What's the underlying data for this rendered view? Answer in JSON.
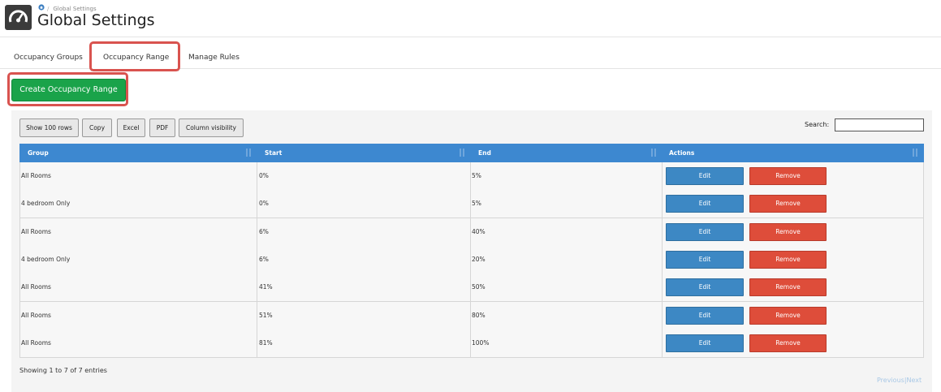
{
  "header": {
    "breadcrumb": "Global Settings",
    "title": "Global Settings"
  },
  "tabs": [
    {
      "label": "Occupancy Groups"
    },
    {
      "label": "Occupancy Range"
    },
    {
      "label": "Manage Rules"
    }
  ],
  "create_button": "Create Occupancy Range",
  "toolbar": {
    "show_rows": "Show 100 rows",
    "copy": "Copy",
    "excel": "Excel",
    "pdf": "PDF",
    "column_visibility": "Column visibility",
    "search_label": "Search:",
    "search_value": ""
  },
  "table": {
    "columns": [
      "Group",
      "Start",
      "End",
      "Actions"
    ],
    "edit_label": "Edit",
    "remove_label": "Remove",
    "rows": [
      {
        "group": "All Rooms",
        "start": "0%",
        "end": "5%"
      },
      {
        "group": "4 bedroom Only",
        "start": "0%",
        "end": "5%"
      },
      {
        "group": "All Rooms",
        "start": "6%",
        "end": "40%"
      },
      {
        "group": "4 bedroom Only",
        "start": "6%",
        "end": "20%"
      },
      {
        "group": "All Rooms",
        "start": "41%",
        "end": "50%"
      },
      {
        "group": "All Rooms",
        "start": "51%",
        "end": "80%"
      },
      {
        "group": "All Rooms",
        "start": "81%",
        "end": "100%"
      }
    ]
  },
  "footer": {
    "info": "Showing 1 to 7 of 7 entries",
    "previous": "Previous",
    "next": "Next"
  },
  "colors": {
    "header_blue": "#3d88d0",
    "create_green": "#1aa34a",
    "edit_blue": "#3d88c4",
    "remove_red": "#de4d3a",
    "highlight_red": "#d9534f"
  }
}
